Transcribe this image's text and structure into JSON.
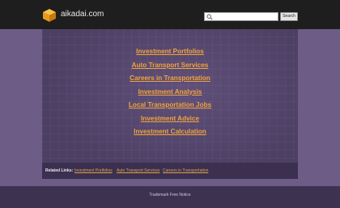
{
  "header": {
    "site_name": "aikadai.com",
    "logo_icon": "cube-logo-icon",
    "search": {
      "placeholder": "",
      "value": "",
      "button_label": "Search",
      "icon": "search-icon"
    }
  },
  "main": {
    "links": [
      "Investment Portfolios",
      "Auto Transport Services",
      "Careers in Transportation",
      "Investment Analysis",
      "Local Transportation Jobs",
      "Investment Advice",
      "Investment Calculation"
    ]
  },
  "related": {
    "label": "Related Links:",
    "links": [
      "Investment Portfolios",
      "Auto Transport Services",
      "Careers in Transportation"
    ]
  },
  "footer": {
    "link": "Trademark Free Notice"
  },
  "colors": {
    "link": "#f2a33a",
    "header_bg": "#1e1e1e",
    "page_bg": "#6a5a82",
    "panel_bg": "#4c3f63"
  }
}
